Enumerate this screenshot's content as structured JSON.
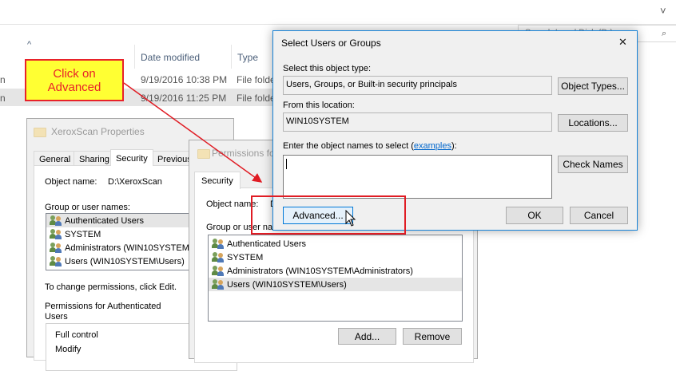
{
  "explorer": {
    "columns": {
      "name_sort_arrow": "^",
      "date_modified": "Date modified",
      "type": "Type"
    },
    "rows": [
      {
        "name_fragment": "n",
        "date": "9/19/2016 10:38 PM",
        "type": "File folde"
      },
      {
        "name_fragment": "n",
        "date": "9/19/2016 11:25 PM",
        "type": "File folde"
      }
    ],
    "search_placeholder": "Search Local Disk (D:)",
    "chevron": "˅",
    "help": "?"
  },
  "callout": {
    "line1": "Click on",
    "line2": "Advanced"
  },
  "properties": {
    "title": "XeroxScan Properties",
    "tabs": [
      "General",
      "Sharing",
      "Security",
      "Previous"
    ],
    "object_name_label": "Object name:",
    "object_name_value": "D:\\XeroxScan",
    "group_label": "Group or user names:",
    "users": [
      "Authenticated Users",
      "SYSTEM",
      "Administrators (WIN10SYSTEM\\A",
      "Users (WIN10SYSTEM\\Users)"
    ],
    "change_hint": "To change permissions, click Edit.",
    "permissions_label_1": "Permissions for Authenticated",
    "permissions_label_2": "Users",
    "permissions": [
      "Full control",
      "Modify"
    ]
  },
  "permissions_dialog": {
    "title": "Permissions for",
    "tab": "Security",
    "object_name_label": "Object name:",
    "object_name_fragment": "D",
    "group_label": "Group or user nam",
    "users": [
      "Authenticated Users",
      "SYSTEM",
      "Administrators (WIN10SYSTEM\\Administrators)",
      "Users (WIN10SYSTEM\\Users)"
    ],
    "add_button": "Add...",
    "remove_button": "Remove"
  },
  "select_dialog": {
    "title": "Select Users or Groups",
    "close": "✕",
    "object_type_label": "Select this object type:",
    "object_type_value": "Users, Groups, or Built-in security principals",
    "object_types_button": "Object Types...",
    "location_label": "From this location:",
    "location_value": "WIN10SYSTEM",
    "locations_button": "Locations...",
    "enter_label_prefix": "Enter the object names to select (",
    "enter_label_link": "examples",
    "enter_label_suffix": "):",
    "names_value": "",
    "check_names_button": "Check Names",
    "advanced_button": "Advanced...",
    "ok_button": "OK",
    "cancel_button": "Cancel"
  }
}
